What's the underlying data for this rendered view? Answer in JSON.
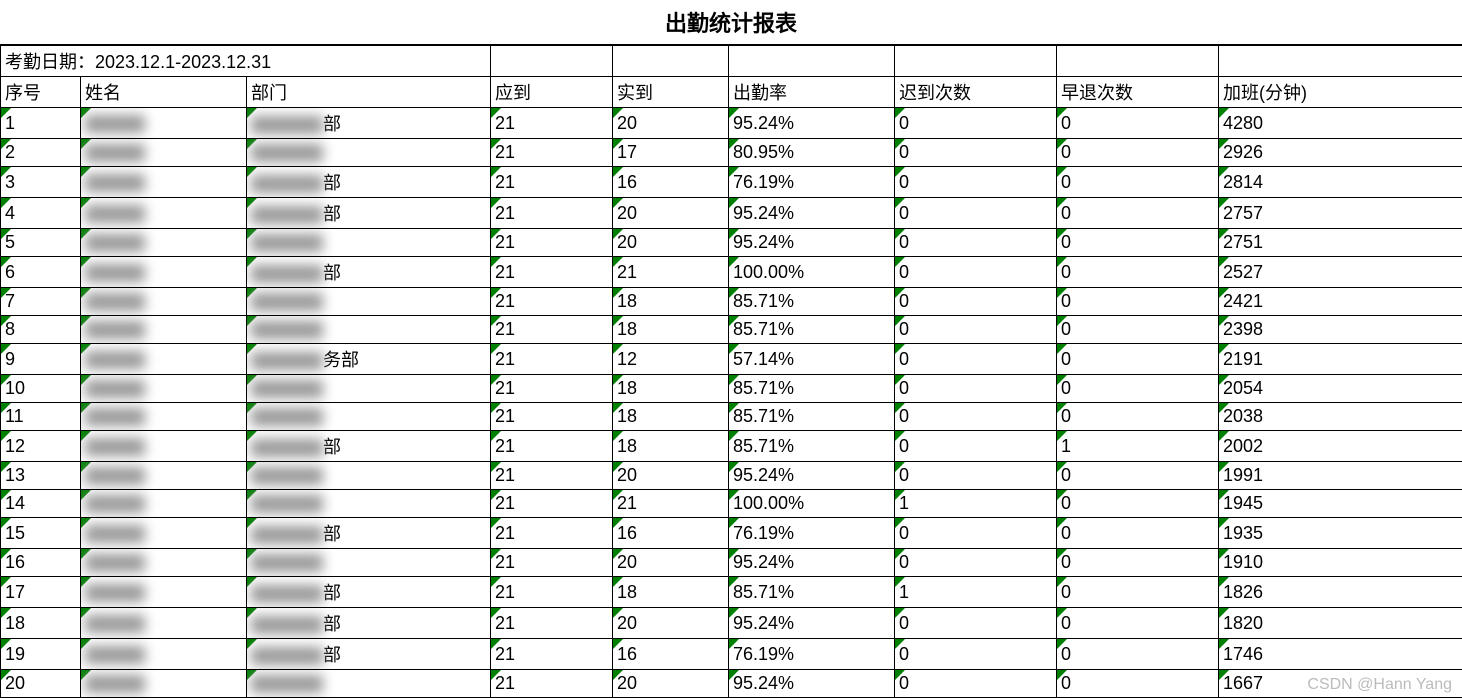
{
  "title": "出勤统计报表",
  "date_label": "考勤日期：2023.12.1-2023.12.31",
  "headers": {
    "seq": "序号",
    "name": "姓名",
    "dept": "部门",
    "expected": "应到",
    "actual": "实到",
    "rate": "出勤率",
    "late": "迟到次数",
    "early": "早退次数",
    "overtime": "加班(分钟)"
  },
  "rows": [
    {
      "seq": "1",
      "name": "",
      "dept": "",
      "dept_suffix": "部",
      "expected": "21",
      "actual": "20",
      "rate": "95.24%",
      "late": "0",
      "early": "0",
      "overtime": "4280"
    },
    {
      "seq": "2",
      "name": "",
      "dept": "",
      "dept_suffix": "",
      "expected": "21",
      "actual": "17",
      "rate": "80.95%",
      "late": "0",
      "early": "0",
      "overtime": "2926"
    },
    {
      "seq": "3",
      "name": "",
      "dept": "",
      "dept_suffix": "部",
      "expected": "21",
      "actual": "16",
      "rate": "76.19%",
      "late": "0",
      "early": "0",
      "overtime": "2814"
    },
    {
      "seq": "4",
      "name": "",
      "dept": "",
      "dept_suffix": "部",
      "expected": "21",
      "actual": "20",
      "rate": "95.24%",
      "late": "0",
      "early": "0",
      "overtime": "2757"
    },
    {
      "seq": "5",
      "name": "",
      "dept": "",
      "dept_suffix": "",
      "expected": "21",
      "actual": "20",
      "rate": "95.24%",
      "late": "0",
      "early": "0",
      "overtime": "2751"
    },
    {
      "seq": "6",
      "name": "",
      "dept": "",
      "dept_suffix": "部",
      "expected": "21",
      "actual": "21",
      "rate": "100.00%",
      "late": "0",
      "early": "0",
      "overtime": "2527"
    },
    {
      "seq": "7",
      "name": "",
      "dept": "",
      "dept_suffix": "",
      "expected": "21",
      "actual": "18",
      "rate": "85.71%",
      "late": "0",
      "early": "0",
      "overtime": "2421"
    },
    {
      "seq": "8",
      "name": "",
      "dept": "",
      "dept_suffix": "",
      "expected": "21",
      "actual": "18",
      "rate": "85.71%",
      "late": "0",
      "early": "0",
      "overtime": "2398"
    },
    {
      "seq": "9",
      "name": "",
      "dept": "",
      "dept_suffix": "务部",
      "expected": "21",
      "actual": "12",
      "rate": "57.14%",
      "late": "0",
      "early": "0",
      "overtime": "2191"
    },
    {
      "seq": "10",
      "name": "",
      "dept": "",
      "dept_suffix": "",
      "expected": "21",
      "actual": "18",
      "rate": "85.71%",
      "late": "0",
      "early": "0",
      "overtime": "2054"
    },
    {
      "seq": "11",
      "name": "",
      "dept": "",
      "dept_suffix": "",
      "expected": "21",
      "actual": "18",
      "rate": "85.71%",
      "late": "0",
      "early": "0",
      "overtime": "2038"
    },
    {
      "seq": "12",
      "name": "",
      "dept": "",
      "dept_suffix": "部",
      "expected": "21",
      "actual": "18",
      "rate": "85.71%",
      "late": "0",
      "early": "1",
      "overtime": "2002"
    },
    {
      "seq": "13",
      "name": "",
      "dept": "",
      "dept_suffix": "",
      "expected": "21",
      "actual": "20",
      "rate": "95.24%",
      "late": "0",
      "early": "0",
      "overtime": "1991"
    },
    {
      "seq": "14",
      "name": "",
      "dept": "",
      "dept_suffix": "",
      "expected": "21",
      "actual": "21",
      "rate": "100.00%",
      "late": "1",
      "early": "0",
      "overtime": "1945"
    },
    {
      "seq": "15",
      "name": "",
      "dept": "",
      "dept_suffix": "部",
      "expected": "21",
      "actual": "16",
      "rate": "76.19%",
      "late": "0",
      "early": "0",
      "overtime": "1935"
    },
    {
      "seq": "16",
      "name": "",
      "dept": "",
      "dept_suffix": "",
      "expected": "21",
      "actual": "20",
      "rate": "95.24%",
      "late": "0",
      "early": "0",
      "overtime": "1910"
    },
    {
      "seq": "17",
      "name": "",
      "dept": "",
      "dept_suffix": "部",
      "expected": "21",
      "actual": "18",
      "rate": "85.71%",
      "late": "1",
      "early": "0",
      "overtime": "1826"
    },
    {
      "seq": "18",
      "name": "",
      "dept": "",
      "dept_suffix": "部",
      "expected": "21",
      "actual": "20",
      "rate": "95.24%",
      "late": "0",
      "early": "0",
      "overtime": "1820"
    },
    {
      "seq": "19",
      "name": "",
      "dept": "",
      "dept_suffix": "部",
      "expected": "21",
      "actual": "16",
      "rate": "76.19%",
      "late": "0",
      "early": "0",
      "overtime": "1746"
    },
    {
      "seq": "20",
      "name": "",
      "dept": "",
      "dept_suffix": "",
      "expected": "21",
      "actual": "20",
      "rate": "95.24%",
      "late": "0",
      "early": "0",
      "overtime": "1667"
    }
  ],
  "watermark": "CSDN @Hann Yang"
}
